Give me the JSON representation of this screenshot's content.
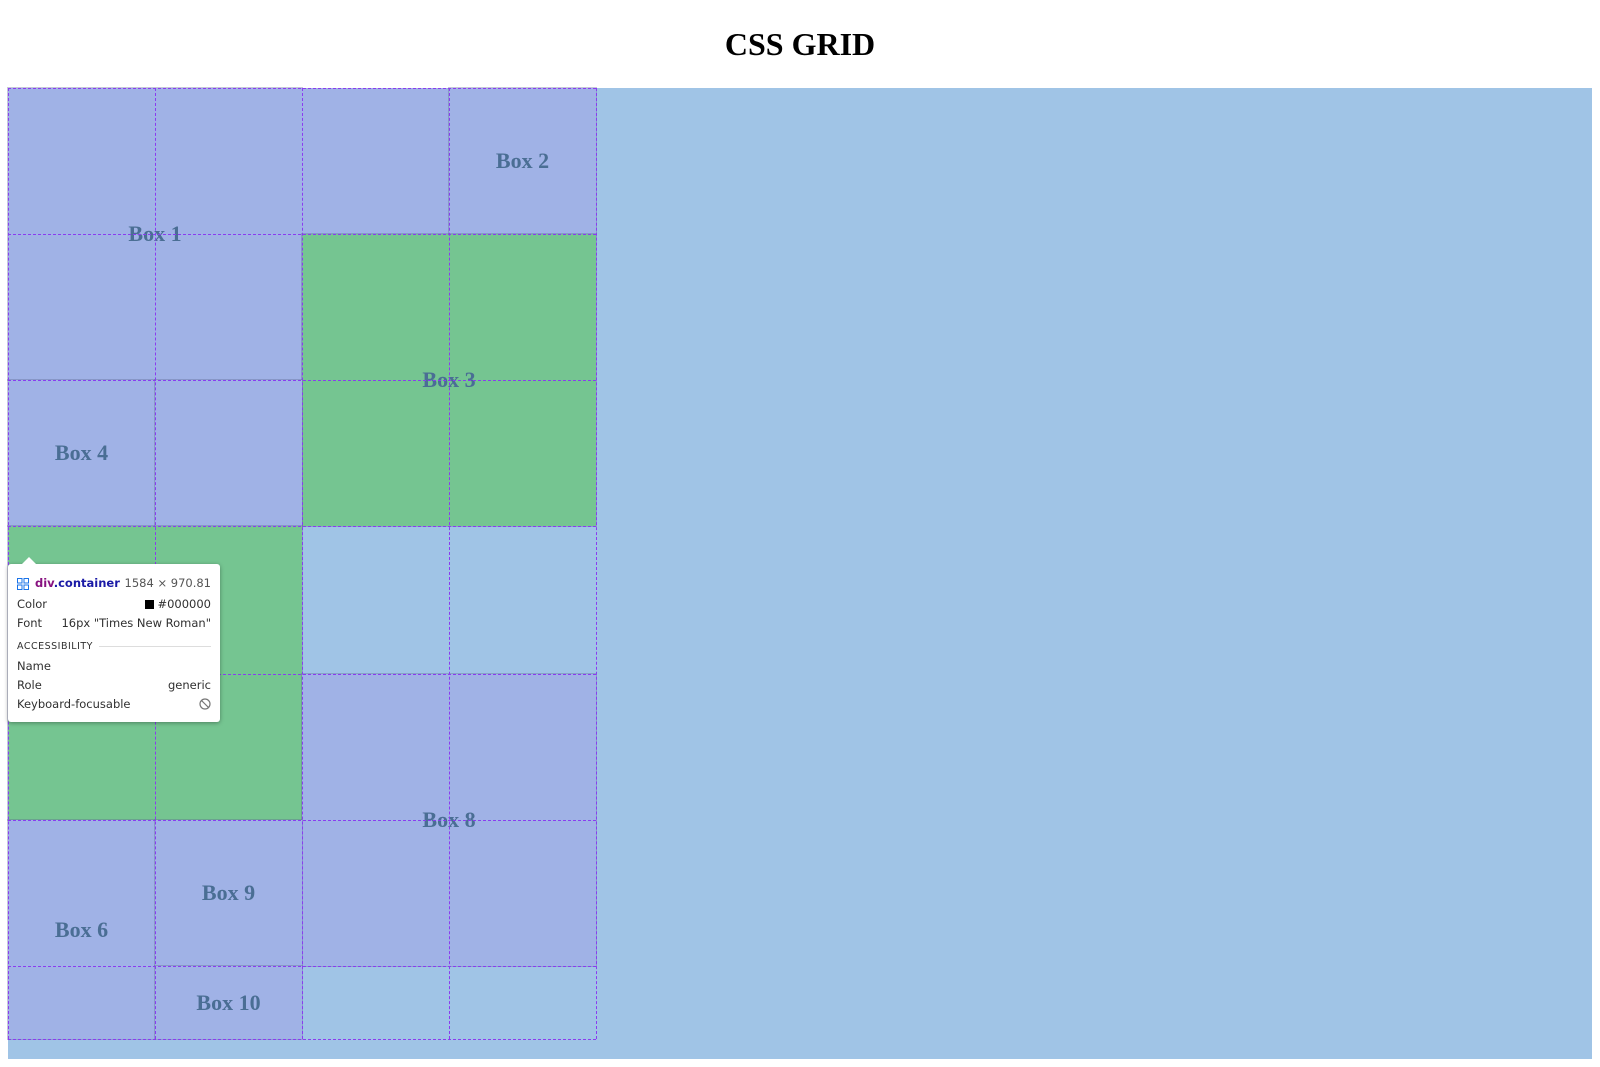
{
  "page": {
    "title": "CSS GRID"
  },
  "grid": {
    "boxes": [
      {
        "label": "Box 1",
        "color": "#a0b2e6"
      },
      {
        "label": "Box 2",
        "color": "#a0b2e6"
      },
      {
        "label": "Box 3",
        "color": "#75c591"
      },
      {
        "label": "Box 4",
        "color": "#a0b2e6"
      },
      {
        "label": "",
        "color": "#a0b2e6"
      },
      {
        "label": "",
        "color": "#75c591"
      },
      {
        "label": "Box 8",
        "color": "#a0b2e6"
      },
      {
        "label": "Box 6",
        "color": "#a0b2e6"
      },
      {
        "label": "Box 9",
        "color": "#a0b2e6"
      },
      {
        "label": "Box 10",
        "color": "#a0b2e6"
      }
    ],
    "container_background": "#a0c4e6",
    "gridline_color": "#8a3cf0"
  },
  "inspector_tooltip": {
    "selector_tag": "div",
    "selector_class": ".container",
    "dimensions": "1584 × 970.81",
    "color_label": "Color",
    "color_value": "#000000",
    "font_label": "Font",
    "font_value": "16px \"Times New Roman\"",
    "accessibility_heading": "ACCESSIBILITY",
    "name_label": "Name",
    "name_value": "",
    "role_label": "Role",
    "role_value": "generic",
    "keyboard_label": "Keyboard-focusable",
    "keyboard_icon": "no-entry-icon"
  }
}
